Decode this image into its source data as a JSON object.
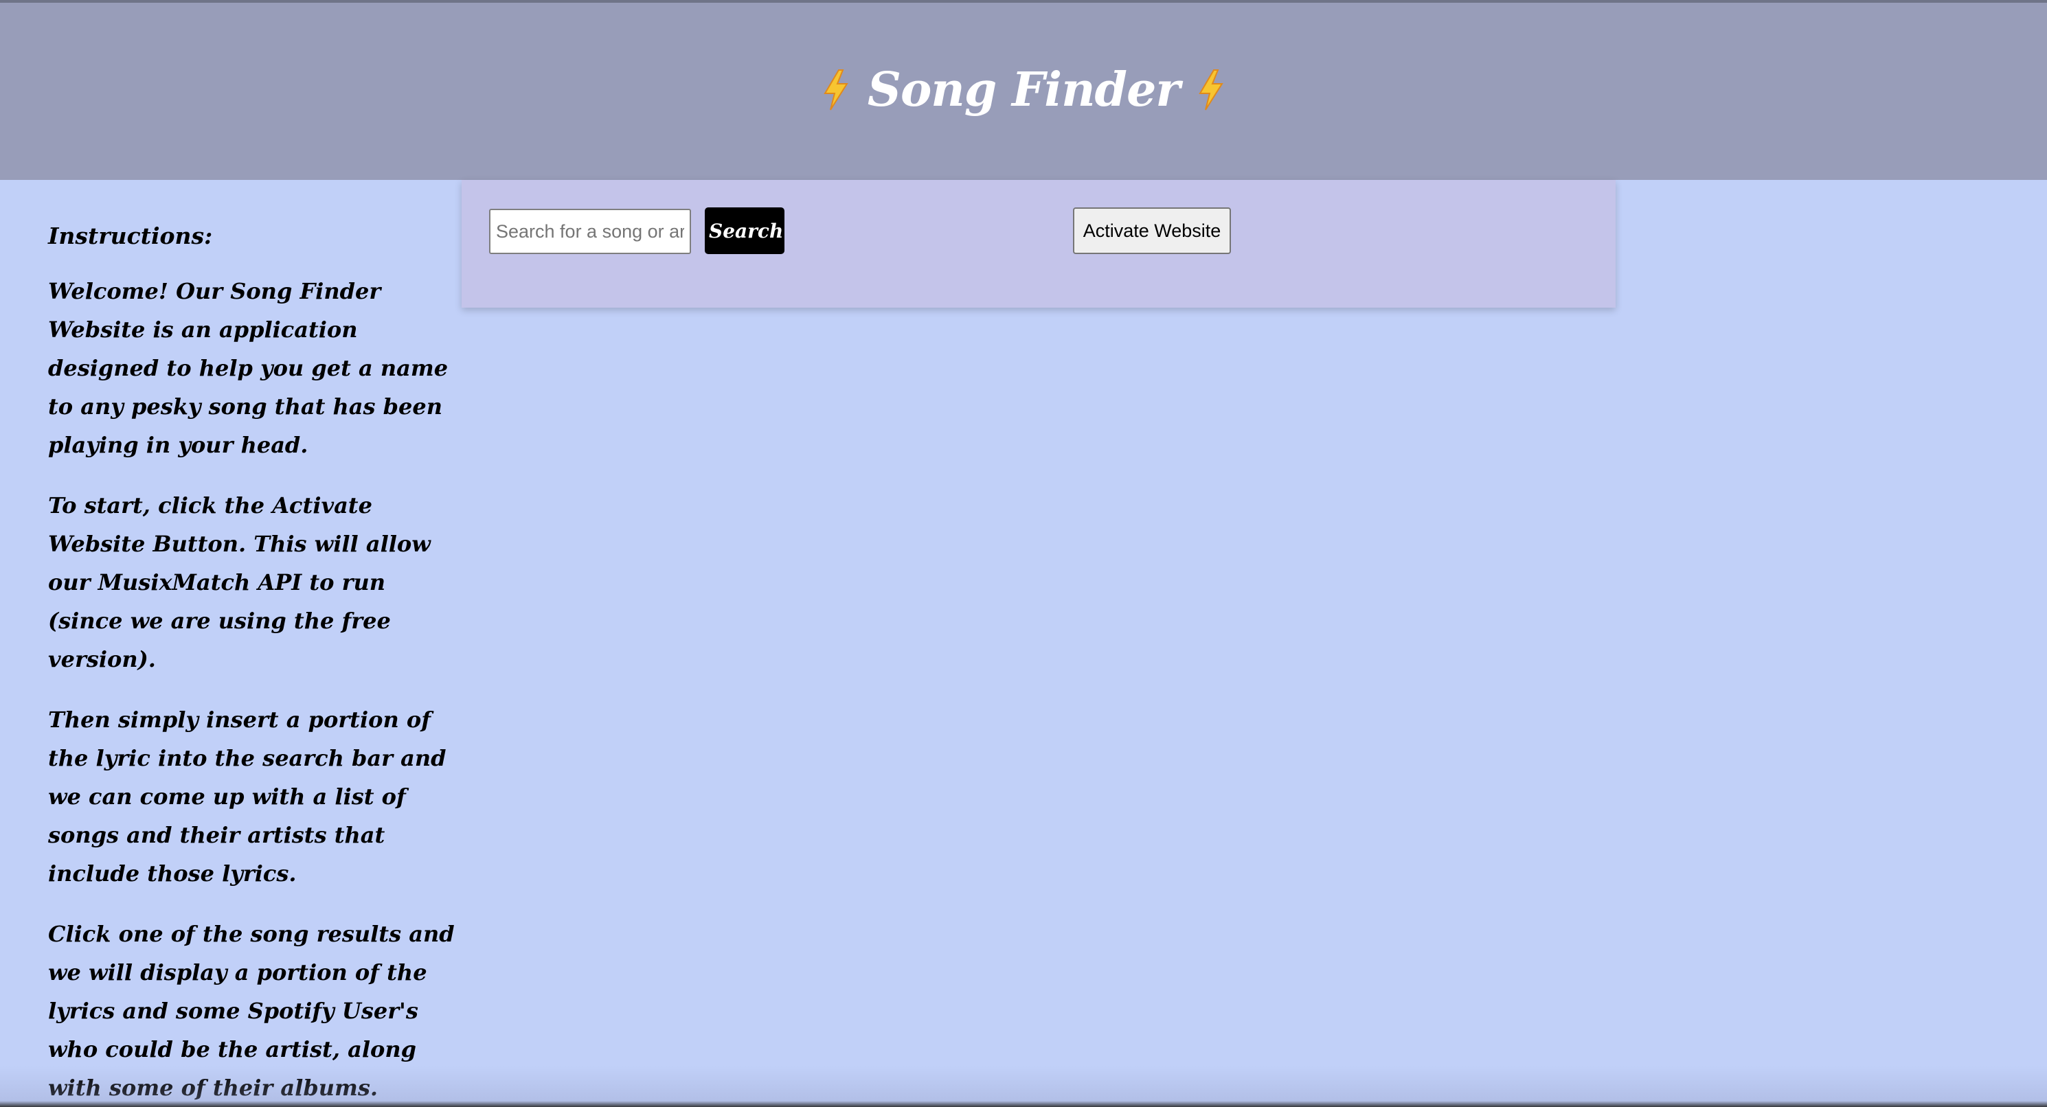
{
  "header": {
    "title": "Song Finder",
    "left_icon": "lightning-bolt-icon",
    "right_icon": "lightning-bolt-icon",
    "background_color": "#989db9",
    "title_color": "#ffffff"
  },
  "sidebar": {
    "heading": "Instructions:",
    "paragraphs": [
      "Welcome! Our Song Finder Website is an application designed to help you get a name to any pesky song that has been playing in your head.",
      "To start, click the Activate Website Button. This will allow our MusixMatch API to run (since we are using the free version).",
      "Then simply insert a portion of the lyric into the search bar and we can come up with a list of songs and their artists that include those lyrics.",
      "Click one of the song results and we will display a portion of the lyrics and some Spotify User's who could be the artist, along with some of their albums."
    ]
  },
  "search": {
    "placeholder": "Search for a song or artist",
    "value": "",
    "button_label": "Search"
  },
  "activate": {
    "button_label": "Activate Website"
  },
  "colors": {
    "page_background": "#c1d0f8",
    "panel_background": "#c4c4ea",
    "search_button": "#000000"
  }
}
